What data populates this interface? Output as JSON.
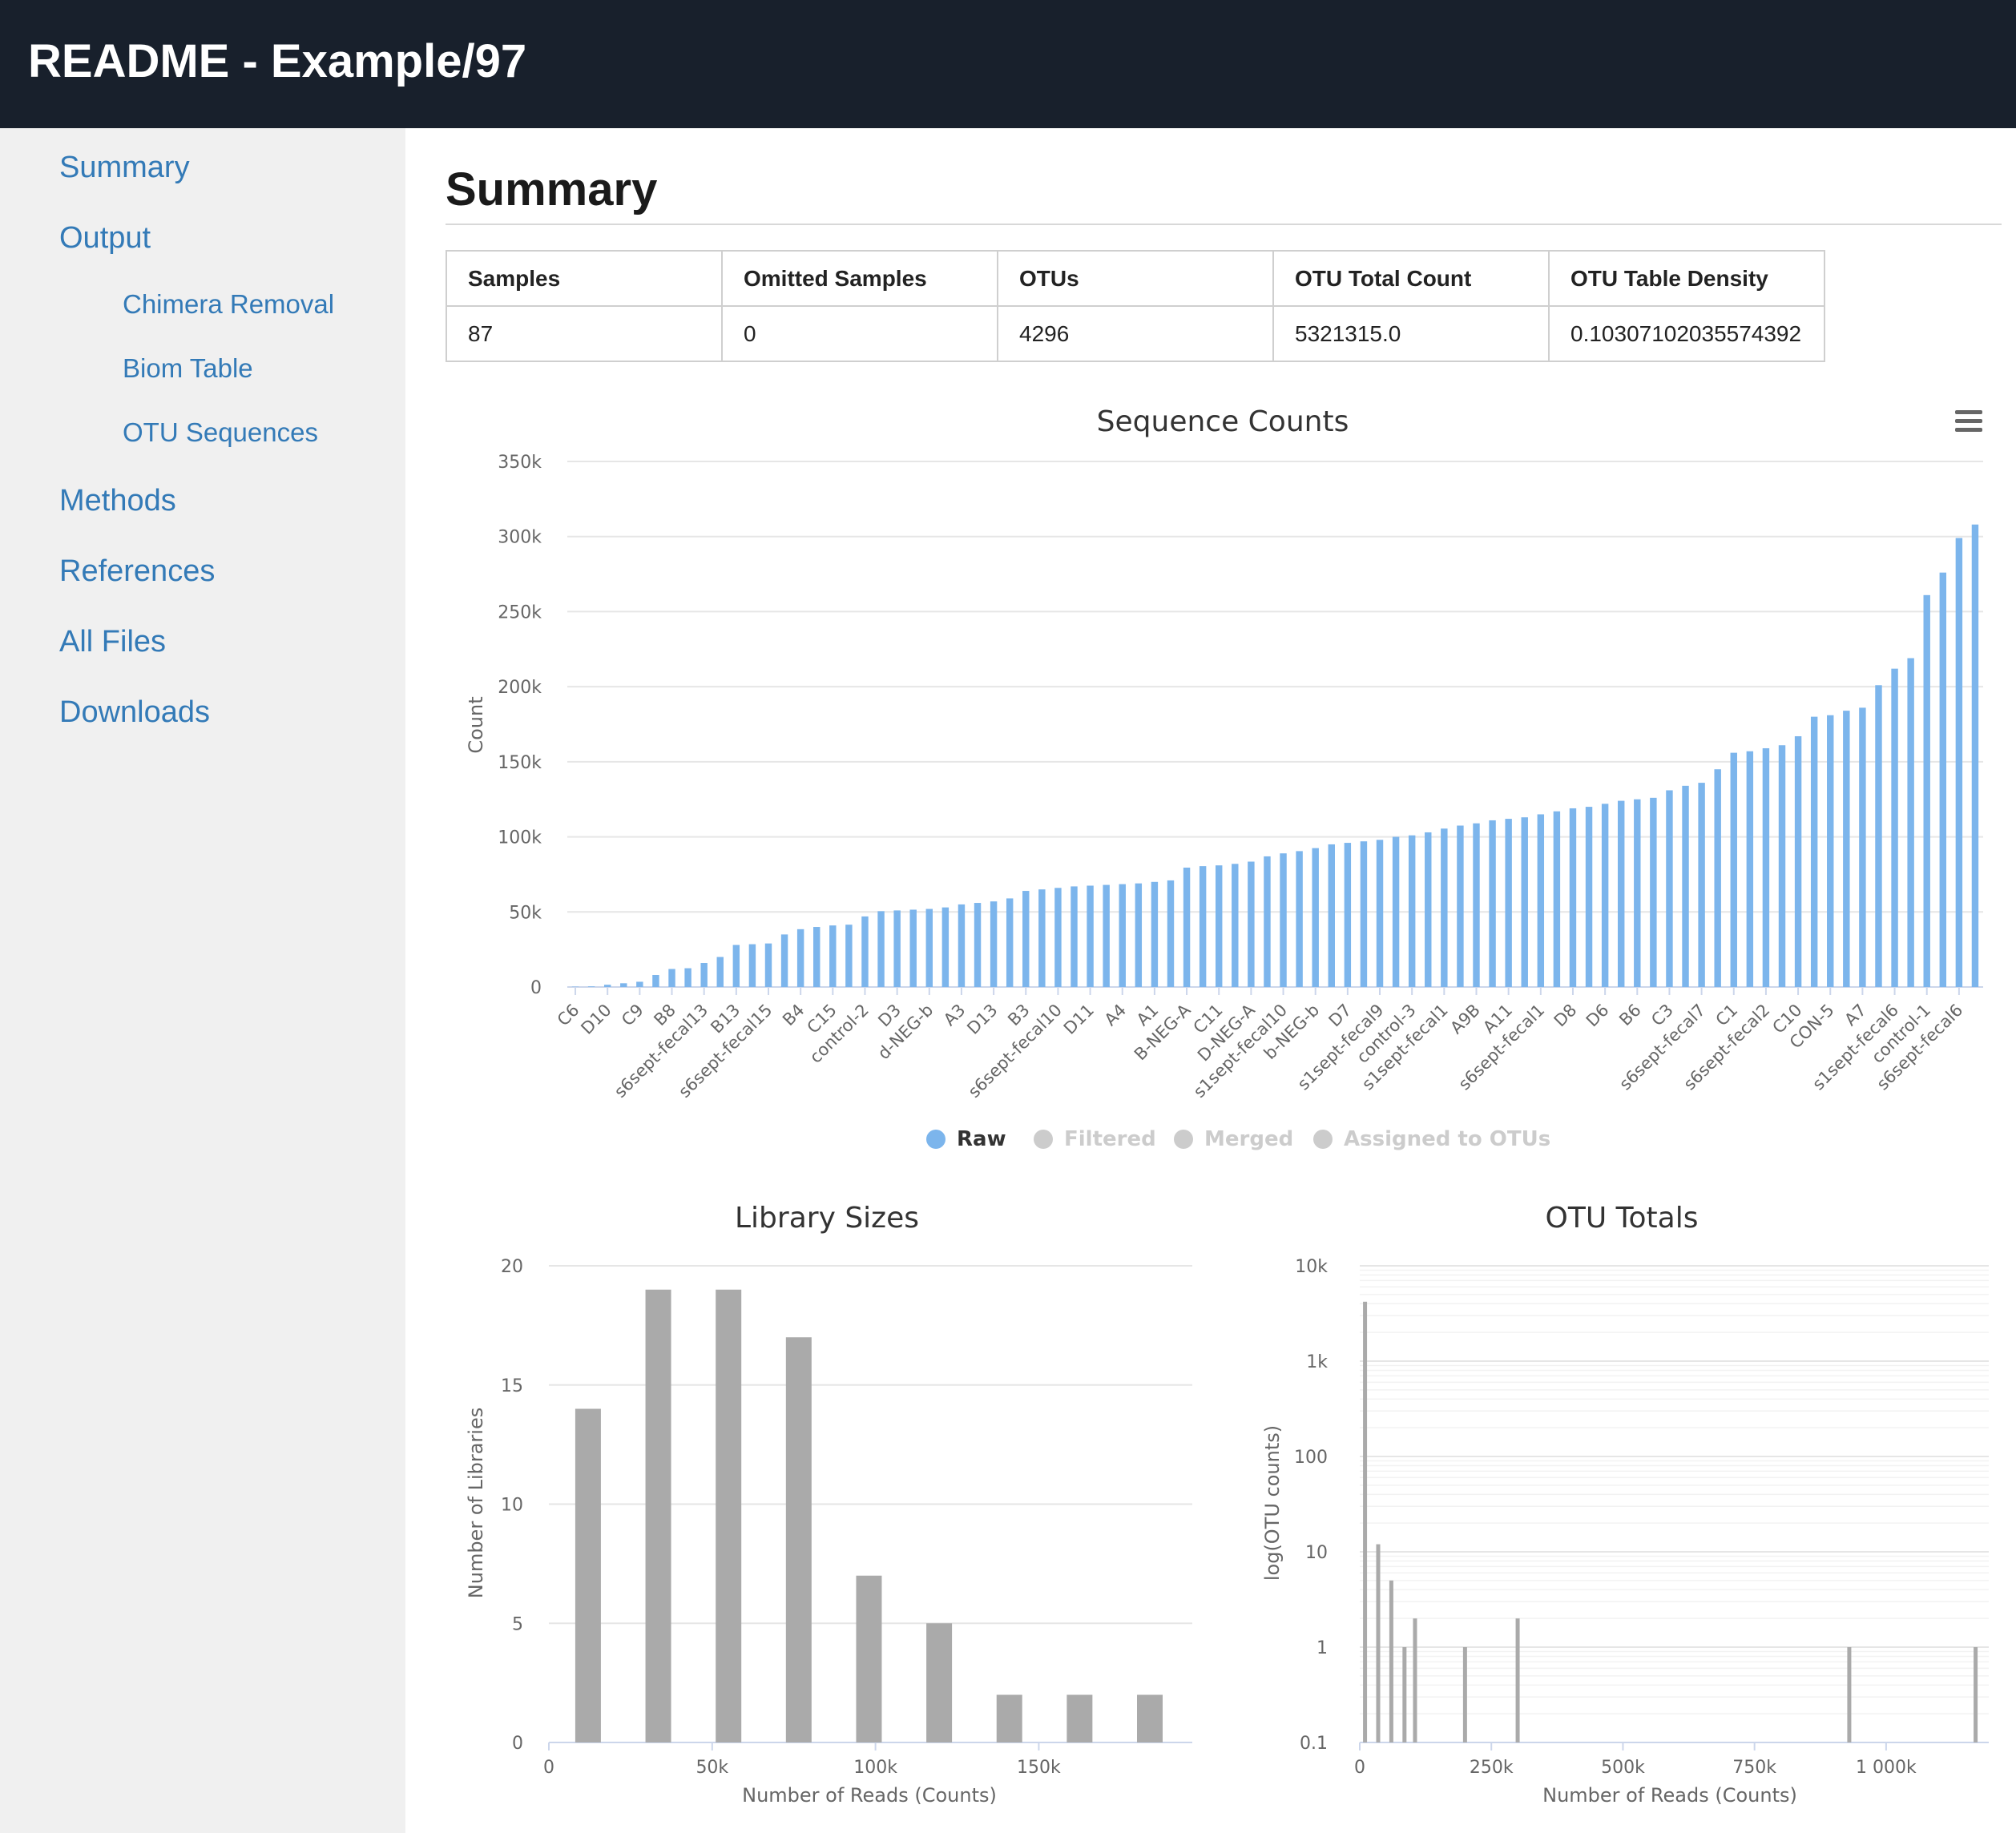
{
  "header": {
    "title": "README - Example/97"
  },
  "sidebar": {
    "items": [
      {
        "label": "Summary"
      },
      {
        "label": "Output"
      },
      {
        "label": "Chimera Removal"
      },
      {
        "label": "Biom Table"
      },
      {
        "label": "OTU Sequences"
      },
      {
        "label": "Methods"
      },
      {
        "label": "References"
      },
      {
        "label": "All Files"
      },
      {
        "label": "Downloads"
      }
    ]
  },
  "main": {
    "title": "Summary",
    "table": {
      "headers": [
        "Samples",
        "Omitted Samples",
        "OTUs",
        "OTU Total Count",
        "OTU Table Density"
      ],
      "row": [
        "87",
        "0",
        "4296",
        "5321315.0",
        "0.10307102035574392"
      ]
    }
  },
  "colors": {
    "accent": "#337ab7",
    "raw": "#7cb5ec",
    "gray_bar": "#aaaaaa",
    "legend_inactive": "#cccccc",
    "header_bg": "#18202c"
  },
  "chart_data": [
    {
      "type": "bar",
      "title": "Sequence Counts",
      "ylabel": "Count",
      "ylim": [
        0,
        350000
      ],
      "yticks": [
        "0",
        "50k",
        "100k",
        "150k",
        "200k",
        "250k",
        "300k",
        "350k"
      ],
      "yticks_values": [
        0,
        50000,
        100000,
        150000,
        200000,
        250000,
        300000,
        350000
      ],
      "grid": true,
      "legend_position": "bottom",
      "category_count": 87,
      "xtick_labels": [
        "C6",
        "D10",
        "C9",
        "B8",
        "s6sept-fecal13",
        "B13",
        "s6sept-fecal15",
        "B4",
        "C15",
        "control-2",
        "D3",
        "d-NEG-b",
        "A3",
        "D13",
        "B3",
        "s6sept-fecal10",
        "D11",
        "A4",
        "A1",
        "B-NEG-A",
        "C11",
        "D-NEG-A",
        "s1sept-fecal10",
        "b-NEG-b",
        "D7",
        "s1sept-fecal9",
        "control-3",
        "s1sept-fecal1",
        "A9B",
        "A11",
        "s6sept-fecal1",
        "D8",
        "D6",
        "B6",
        "C3",
        "s6sept-fecal7",
        "C1",
        "s6sept-fecal2",
        "C10",
        "CON-5",
        "A7",
        "s1sept-fecal6",
        "control-1",
        "s6sept-fecal6"
      ],
      "series": [
        {
          "name": "Raw",
          "active": true,
          "values": [
            200,
            400,
            1500,
            2500,
            3500,
            8000,
            12000,
            12500,
            16000,
            20000,
            28000,
            28500,
            29000,
            35000,
            38500,
            40000,
            41000,
            41500,
            47000,
            50500,
            51000,
            51500,
            52000,
            53000,
            55000,
            56000,
            57000,
            59000,
            64000,
            65000,
            66000,
            67000,
            67500,
            68000,
            68500,
            69000,
            70000,
            71000,
            79500,
            80500,
            81000,
            82000,
            83500,
            87000,
            89000,
            90500,
            92500,
            95000,
            96000,
            97000,
            98000,
            100000,
            101000,
            103000,
            105500,
            107500,
            109000,
            111000,
            112000,
            113000,
            115000,
            117000,
            119000,
            120000,
            122000,
            124000,
            125000,
            126000,
            131000,
            134000,
            136000,
            145000,
            156000,
            157000,
            159000,
            161000,
            167000,
            180000,
            181000,
            184000,
            186000,
            201000,
            212000,
            219000,
            261000,
            276000,
            299000,
            308000
          ]
        },
        {
          "name": "Filtered",
          "active": false
        },
        {
          "name": "Merged",
          "active": false
        },
        {
          "name": "Assigned to OTUs",
          "active": false
        }
      ]
    },
    {
      "type": "bar",
      "title": "Library Sizes",
      "xlabel": "Number of Reads (Counts)",
      "ylabel": "Number of Libraries",
      "ylim": [
        0,
        20
      ],
      "yticks": [
        "0",
        "5",
        "10",
        "15",
        "20"
      ],
      "xticks": [
        "0",
        "50k",
        "100k",
        "150k"
      ],
      "xticks_values": [
        0,
        50000,
        100000,
        150000
      ],
      "xlim": [
        0,
        197000
      ],
      "bin_centers": [
        12000,
        33500,
        55000,
        76500,
        98000,
        119500,
        141000,
        162500,
        184000
      ],
      "values": [
        14,
        19,
        19,
        17,
        7,
        5,
        2,
        2,
        2
      ]
    },
    {
      "type": "bar",
      "title": "OTU Totals",
      "xlabel": "Number of Reads (Counts)",
      "ylabel": "log(OTU counts)",
      "y_scale": "log",
      "ylim": [
        0.1,
        10000
      ],
      "yticks": [
        "0.1",
        "1",
        "10",
        "100",
        "1k",
        "10k"
      ],
      "yticks_values": [
        0.1,
        1,
        10,
        100,
        1000,
        10000
      ],
      "xticks": [
        "0",
        "250k",
        "500k",
        "750k",
        "1 000k"
      ],
      "xticks_values": [
        0,
        250000,
        500000,
        750000,
        1000000
      ],
      "xlim": [
        0,
        1195000
      ],
      "x": [
        10000,
        35000,
        60000,
        85000,
        105000,
        200000,
        300000,
        930000,
        1170000
      ],
      "values": [
        4200,
        12,
        5,
        1,
        2,
        1,
        2,
        1,
        1
      ]
    }
  ]
}
